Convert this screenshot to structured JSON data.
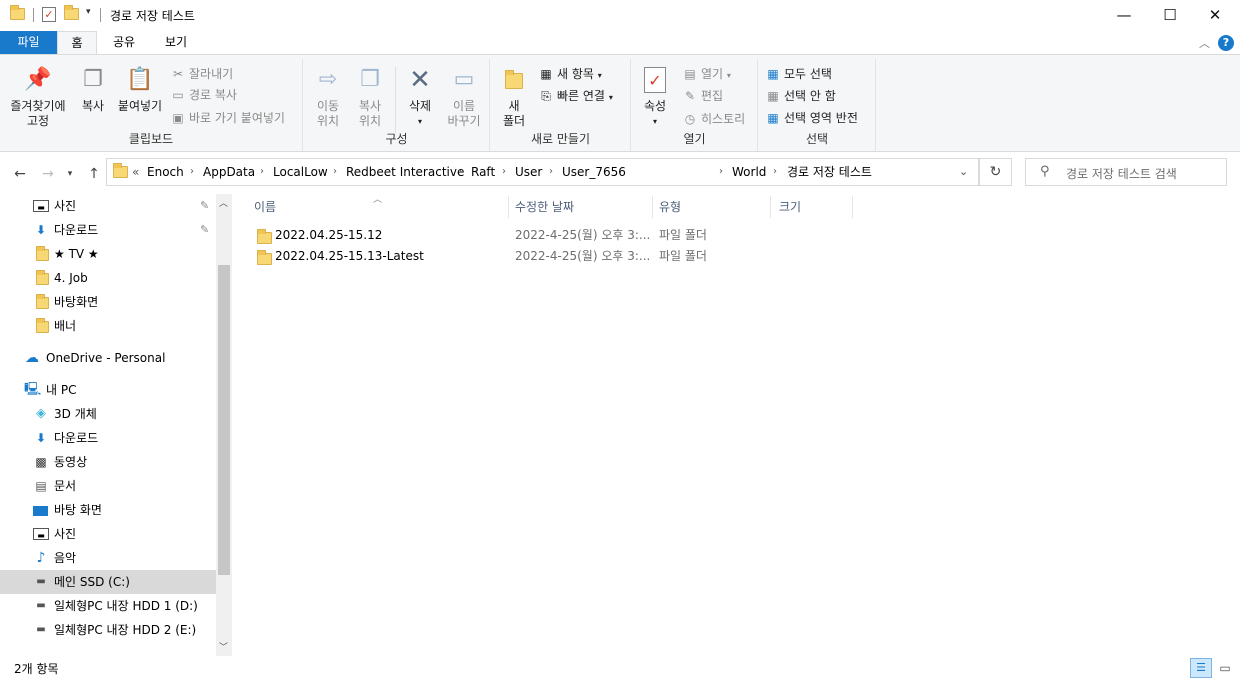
{
  "window": {
    "title": "경로 저장 테스트",
    "controls": {
      "minimize": "—",
      "maximize": "☐",
      "close": "✕"
    }
  },
  "tabs": [
    {
      "label": "파일",
      "active_blue": true
    },
    {
      "label": "홈",
      "selected": true
    },
    {
      "label": "공유"
    },
    {
      "label": "보기"
    }
  ],
  "ribbon": {
    "clipboard": {
      "label": "클립보드",
      "pin": "즐겨찾기에\n고정",
      "pin_l1": "즐겨찾기에",
      "pin_l2": "고정",
      "copy": "복사",
      "paste": "붙여넣기",
      "cut": "잘라내기",
      "copy_path": "경로 복사",
      "paste_shortcut": "바로 가기 붙여넣기"
    },
    "organize": {
      "label": "구성",
      "move_l1": "이동",
      "move_l2": "위치",
      "copy_l1": "복사",
      "copy_l2": "위치",
      "delete": "삭제",
      "rename_l1": "이름",
      "rename_l2": "바꾸기"
    },
    "new": {
      "label": "새로 만들기",
      "folder_l1": "새",
      "folder_l2": "폴더",
      "new_item": "새 항목",
      "easy_access": "빠른 연결"
    },
    "open": {
      "label": "열기",
      "properties": "속성",
      "open": "열기",
      "edit": "편집",
      "history": "히스토리"
    },
    "select": {
      "label": "선택",
      "all": "모두 선택",
      "none": "선택 안 함",
      "invert": "선택 영역 반전"
    }
  },
  "address": {
    "overflow": "«",
    "crumbs": [
      "Enoch",
      "AppData",
      "LocalLow",
      "Redbeet Interactive",
      "Raft",
      "User",
      "User_7656",
      "World",
      "경로 저장 테스트"
    ]
  },
  "search": {
    "placeholder": "경로 저장 테스트 검색"
  },
  "nav": {
    "items": [
      {
        "label": "사진",
        "icon": "pictures-icon",
        "pinned": true
      },
      {
        "label": "다운로드",
        "icon": "download-icon",
        "pinned": true
      },
      {
        "label": "★ TV ★",
        "icon": "folder-icon"
      },
      {
        "label": "4. Job",
        "icon": "folder-icon"
      },
      {
        "label": "바탕화면",
        "icon": "folder-icon"
      },
      {
        "label": "배너",
        "icon": "folder-icon"
      },
      {
        "label": "OneDrive - Personal",
        "icon": "onedrive-icon"
      },
      {
        "label": "내 PC",
        "icon": "pc-icon"
      },
      {
        "label": "3D 개체",
        "icon": "3d-objects-icon"
      },
      {
        "label": "다운로드",
        "icon": "download-icon"
      },
      {
        "label": "동영상",
        "icon": "video-icon"
      },
      {
        "label": "문서",
        "icon": "documents-icon"
      },
      {
        "label": "바탕 화면",
        "icon": "desktop-icon"
      },
      {
        "label": "사진",
        "icon": "pictures-icon"
      },
      {
        "label": "음악",
        "icon": "music-icon"
      },
      {
        "label": "메인 SSD (C:)",
        "icon": "drive-icon",
        "selected": true
      },
      {
        "label": "일체형PC 내장 HDD 1 (D:)",
        "icon": "drive-icon"
      },
      {
        "label": "일체형PC 내장 HDD 2 (E:)",
        "icon": "drive-icon"
      }
    ]
  },
  "columns": [
    "이름",
    "수정한 날짜",
    "유형",
    "크기"
  ],
  "files": [
    {
      "name": "2022.04.25-15.12",
      "date": "2022-4-25(월) 오후 3:...",
      "type": "파일 폴더",
      "size": ""
    },
    {
      "name": "2022.04.25-15.13-Latest",
      "date": "2022-4-25(월) 오후 3:...",
      "type": "파일 폴더",
      "size": ""
    }
  ],
  "status": {
    "count": "2개 항목"
  },
  "colors": {
    "accent": "#1979ca",
    "selected": "#cce8ff",
    "nav_selected": "#d9d9d9"
  }
}
